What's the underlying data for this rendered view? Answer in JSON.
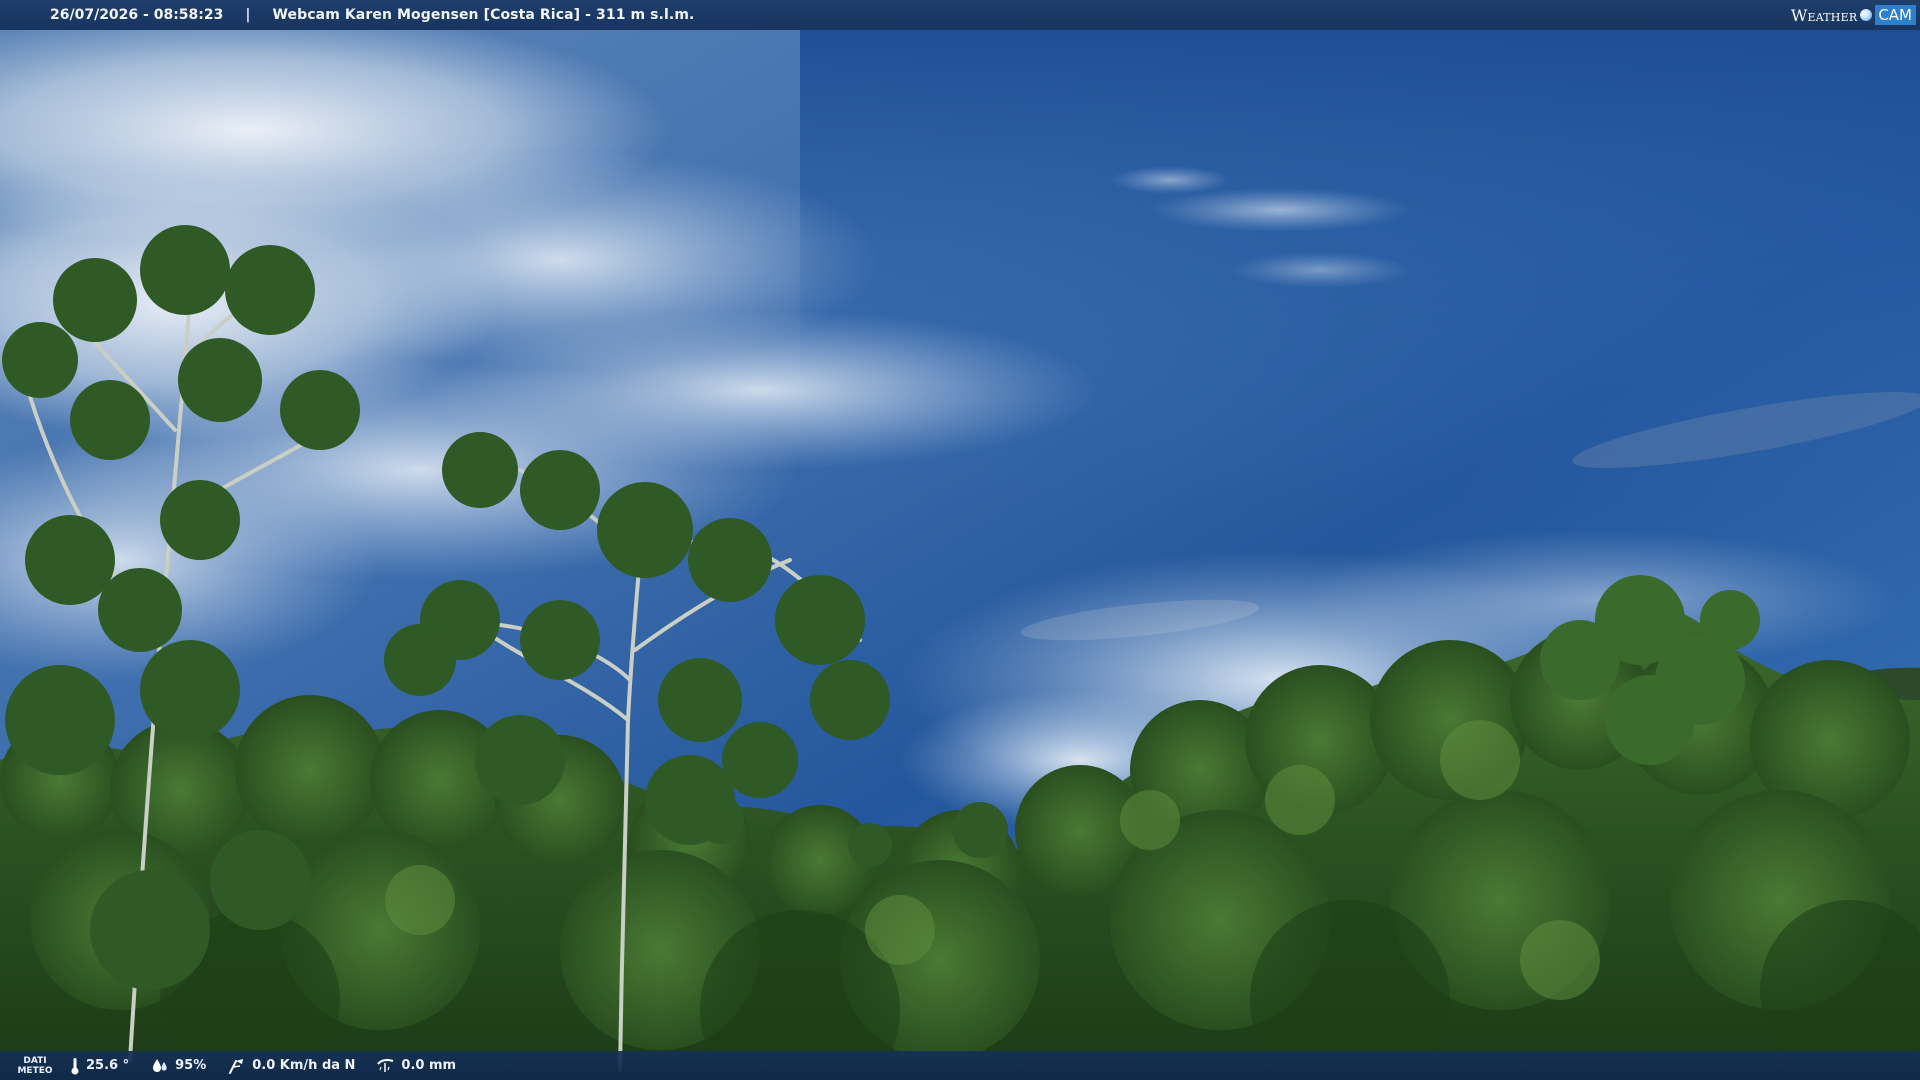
{
  "overlay": {
    "datetime": "26/07/2026 - 08:58:23",
    "separator": "|",
    "title": "Webcam Karen Mogensen [Costa Rica]  - 311 m s.l.m."
  },
  "logo": {
    "weather": "Weather",
    "cam": "CAM"
  },
  "weather_bar": {
    "label_line1": "DATI",
    "label_line2": "METEO",
    "temperature": "25.6 °",
    "humidity": "95%",
    "wind": "0.0 Km/h da N",
    "rain": "0.0 mm"
  },
  "icons": {
    "temperature": "thermometer-icon",
    "humidity": "humidity-drops-icon",
    "wind": "wind-icon",
    "rain": "rain-gauge-icon"
  },
  "colors": {
    "bar_background": "#1b3a66",
    "sky_top": "#1d4e95",
    "foliage": "#2e5a25"
  }
}
